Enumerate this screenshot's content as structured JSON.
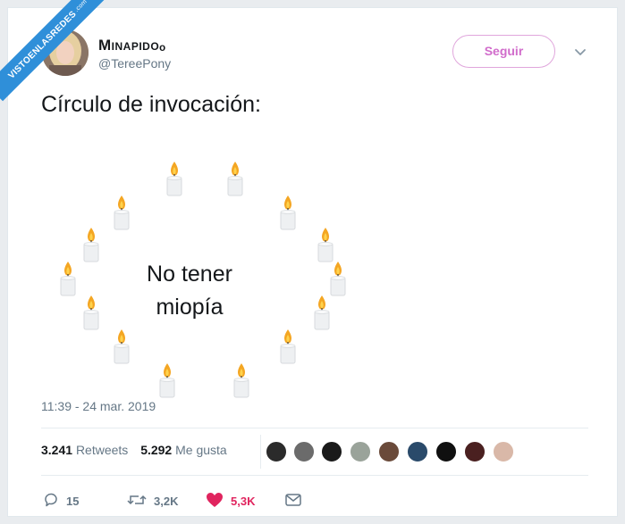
{
  "watermark": {
    "main": "VISTOENLASREDES",
    "sub": ".com"
  },
  "user": {
    "display_name": "Minapidoₒ",
    "handle": "@TereePony"
  },
  "follow_label": "Seguir",
  "tweet": {
    "text": "Círculo de invocación:",
    "center_text": "No tener\nmiopía",
    "timestamp": "11:39 - 24 mar. 2019"
  },
  "stats": {
    "retweets_count": "3.241",
    "retweets_label": "Retweets",
    "likes_count": "5.292",
    "likes_label": "Me gusta"
  },
  "actions": {
    "replies": "15",
    "retweets": "3,2K",
    "likes": "5,3K"
  },
  "colors": {
    "follow": "#d16ccb",
    "like": "#e0245e",
    "banner": "#2f8fd9"
  },
  "icons": [
    "chevron-down-icon",
    "candle-icon",
    "reply-icon",
    "retweet-icon",
    "heart-icon",
    "message-icon"
  ]
}
